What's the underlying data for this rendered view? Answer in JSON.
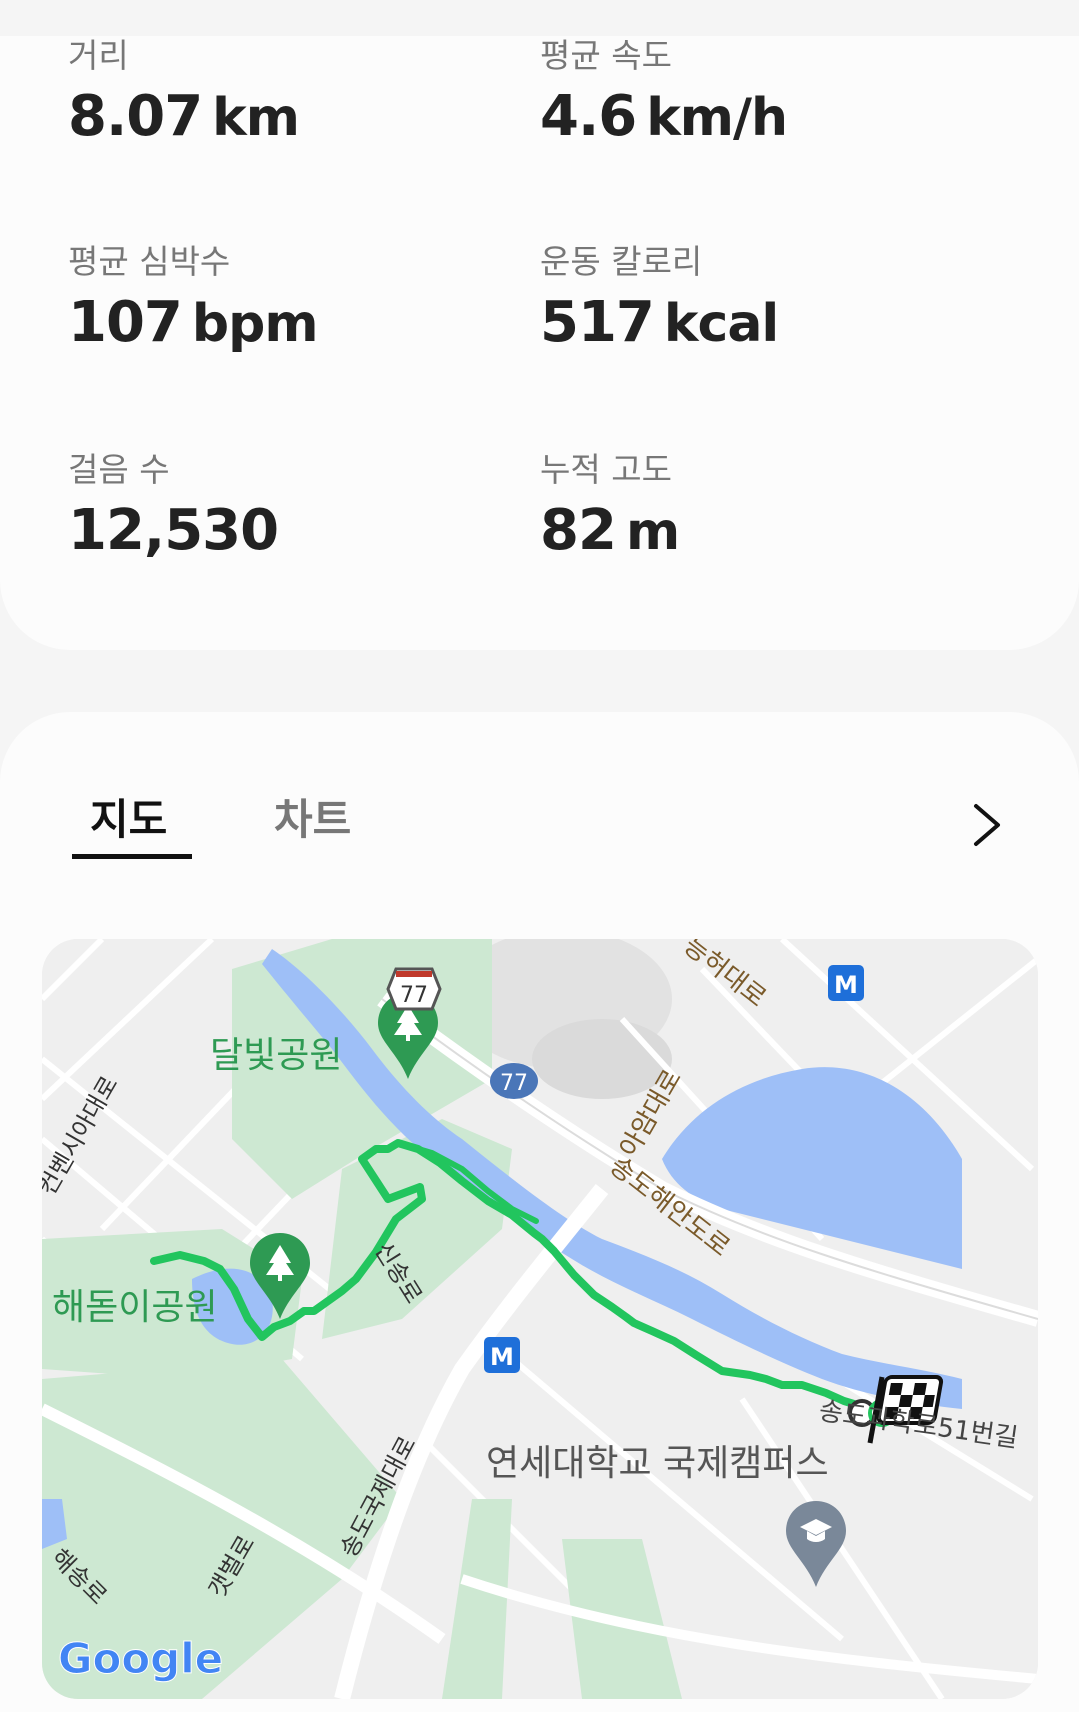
{
  "stats": [
    {
      "label": "거리",
      "value": "8.07",
      "unit": "km"
    },
    {
      "label": "평균 속도",
      "value": "4.6",
      "unit": "km/h"
    },
    {
      "label": "평균 심박수",
      "value": "107",
      "unit": "bpm"
    },
    {
      "label": "운동 칼로리",
      "value": "517",
      "unit": "kcal"
    },
    {
      "label": "걸음 수",
      "value": "12,530",
      "unit": ""
    },
    {
      "label": "누적 고도",
      "value": "82",
      "unit": "m"
    }
  ],
  "tabs": {
    "map": "지도",
    "chart": "차트",
    "active": "map"
  },
  "map": {
    "labels": {
      "moon_park": "달빛공원",
      "haedoji_park": "해돋이공원",
      "road_77a": "77",
      "road_77b": "77",
      "road_heui": "능허대로",
      "road_aam": "아암대로",
      "road_coast": "송도해안도로",
      "road_convensia": "컨벤시아대로",
      "road_sinsong": "신송로",
      "road_songdo_intl": "송도국제대로",
      "road_gaetbeol": "갯벌로",
      "road_haesong": "해송로",
      "road_51": "송도과학로51번길",
      "yonsei": "연세대학교 국제캠퍼스",
      "metro_1": "M",
      "metro_2": "M",
      "google": "Google"
    },
    "colors": {
      "route": "#22c55e",
      "water": "#9ebff7",
      "park": "#cfe8d5",
      "pin_green": "#2e9a53",
      "metro": "#1e6fd9"
    },
    "icons": [
      "park-tree-icon",
      "university-icon",
      "finish-flag-icon",
      "metro-icon"
    ]
  }
}
